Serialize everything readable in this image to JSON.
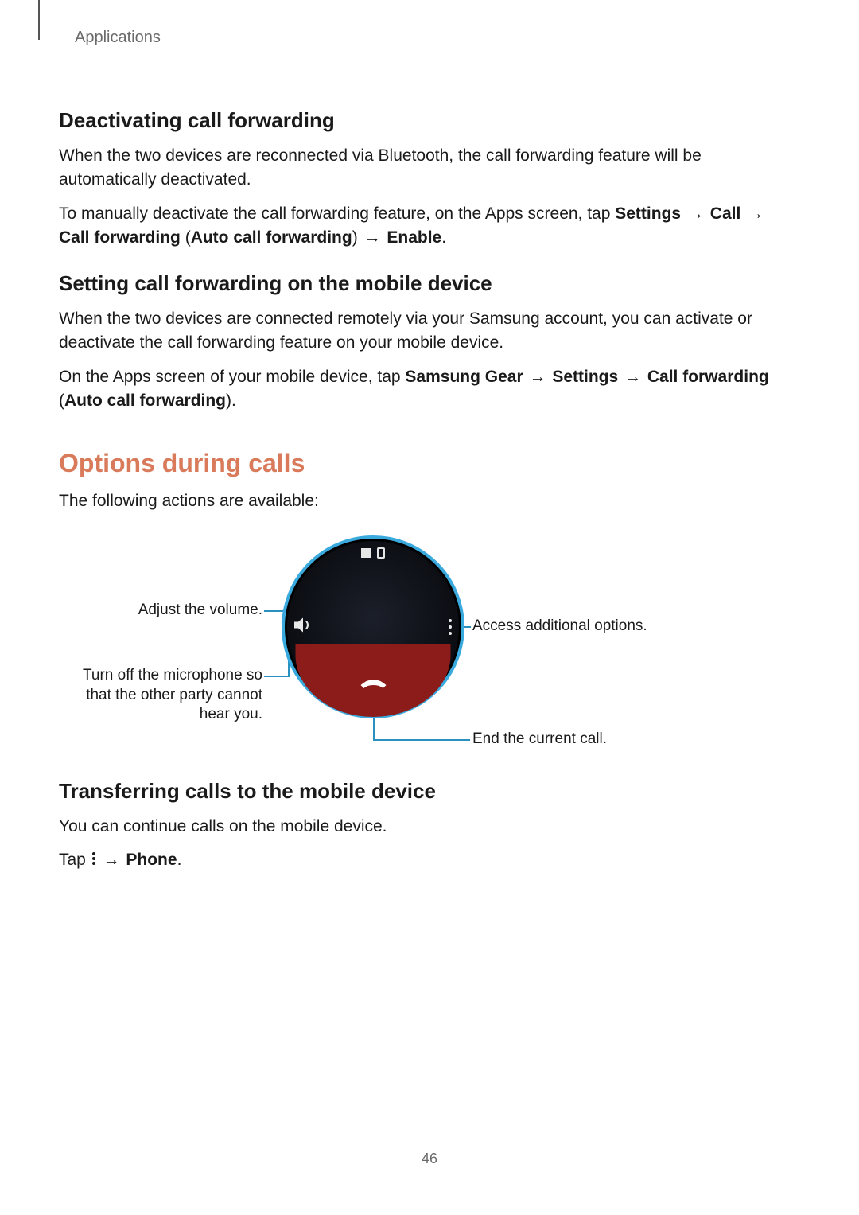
{
  "header": {
    "breadcrumb": "Applications"
  },
  "sections": {
    "deact": {
      "title": "Deactivating call forwarding",
      "p1": "When the two devices are reconnected via Bluetooth, the call forwarding feature will be automatically deactivated.",
      "p2_pre": "To manually deactivate the call forwarding feature, on the Apps screen, tap ",
      "p2_b1": "Settings",
      "arrow": "→",
      "p2_b2": "Call",
      "p2_b3": "Call forwarding",
      "p2_paren_open": " (",
      "p2_b4": "Auto call forwarding",
      "p2_paren_close": ") ",
      "p2_b5": "Enable",
      "period": "."
    },
    "setcf": {
      "title": "Setting call forwarding on the mobile device",
      "p1": "When the two devices are connected remotely via your Samsung account, you can activate or deactivate the call forwarding feature on your mobile device.",
      "p2_pre": "On the Apps screen of your mobile device, tap ",
      "p2_b1": "Samsung Gear",
      "p2_b2": "Settings",
      "p2_b3": "Call forwarding",
      "p2_b4": "Auto call forwarding"
    },
    "options": {
      "title": "Options during calls",
      "intro": "The following actions are available:",
      "callouts": {
        "volume": "Adjust the volume.",
        "mute": "Turn off the microphone so that the other party cannot hear you.",
        "more": "Access additional options.",
        "end": "End the current call."
      }
    },
    "transfer": {
      "title": "Transferring calls to the mobile device",
      "p1": "You can continue calls on the mobile device.",
      "p2_pre": "Tap ",
      "p2_b1": "Phone"
    }
  },
  "page_number": "46"
}
